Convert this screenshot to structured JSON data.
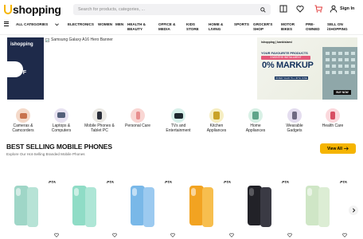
{
  "brand": {
    "name": "shopping",
    "accent": "#f5b400"
  },
  "header": {
    "search_placeholder": "Search for products, categories, ...",
    "signin_label": "Sign In"
  },
  "nav": {
    "all_categories": "ALL CATEGORIES",
    "items": [
      {
        "label": "ELECTRONICS"
      },
      {
        "label": "WOMEN"
      },
      {
        "label": "MEN"
      },
      {
        "label": "HEALTH &\nBEAUTY"
      },
      {
        "label": "OFFICE &\nMEDIA"
      },
      {
        "label": "KIDS\nSTORE"
      },
      {
        "label": "HOME &\nLIVING"
      },
      {
        "label": "SPORTS"
      },
      {
        "label": "GROCER'S\nSHOP"
      },
      {
        "label": "MOTOR\nBIKES"
      },
      {
        "label": "PRE-\nOWNED"
      },
      {
        "label": "SELL ON\niSHOPPING"
      }
    ]
  },
  "banner": {
    "left_logo": "ishopping",
    "left_badge": "%\nOFF",
    "broken_alt": "Samsung Galaxy A16 Hero Banner",
    "right": {
      "brand": "ishopping | bankislami",
      "caption": "YOUR FAVOURITE PRODUCTS",
      "pill": "3 MONTHS INSTALLMENT",
      "big": "0% MARKUP",
      "foot": "OFFER VALID TILL 30TH JUNE",
      "cta": "BUY NOW"
    }
  },
  "categories": [
    {
      "label": "Cameras &\nCamcorders",
      "color": "#f4d9c9",
      "icon": "camera-icon"
    },
    {
      "label": "Laptops &\nComputers",
      "color": "#e7e2f1",
      "icon": "laptop-icon"
    },
    {
      "label": "Mobile Phones &\nTablet PC",
      "color": "#ebe9e4",
      "icon": "mobile-icon"
    },
    {
      "label": "Personal Care",
      "color": "#f9d6d3",
      "icon": "personal-care-icon"
    },
    {
      "label": "TVs and\nEntertainment",
      "color": "#d7f0ea",
      "icon": "tv-icon"
    },
    {
      "label": "Kitchen\nAppliances",
      "color": "#f6eec2",
      "icon": "kitchen-icon"
    },
    {
      "label": "Home\nAppliances",
      "color": "#d9f1e6",
      "icon": "home-appliance-icon"
    },
    {
      "label": "Wearable\nGadgets",
      "color": "#e4ddef",
      "icon": "watch-icon"
    },
    {
      "label": "Health Care",
      "color": "#fbd9dd",
      "icon": "health-icon"
    }
  ],
  "section": {
    "title": "BEST SELLING MOBILE PHONES",
    "subtitle": "Explore Our Hot-Selling Branded Mobile Phones",
    "view_all": "View All"
  },
  "products": [
    {
      "badge": "PTA",
      "color": "#9fd6c7"
    },
    {
      "badge": "PTA",
      "color": "#8fdcc6"
    },
    {
      "badge": "PTA",
      "color": "#79b8e8"
    },
    {
      "badge": "PTA",
      "color": "#f2a321"
    },
    {
      "badge": "PTA",
      "color": "#222228"
    },
    {
      "badge": "PTA",
      "color": "#cfe6c6"
    }
  ]
}
